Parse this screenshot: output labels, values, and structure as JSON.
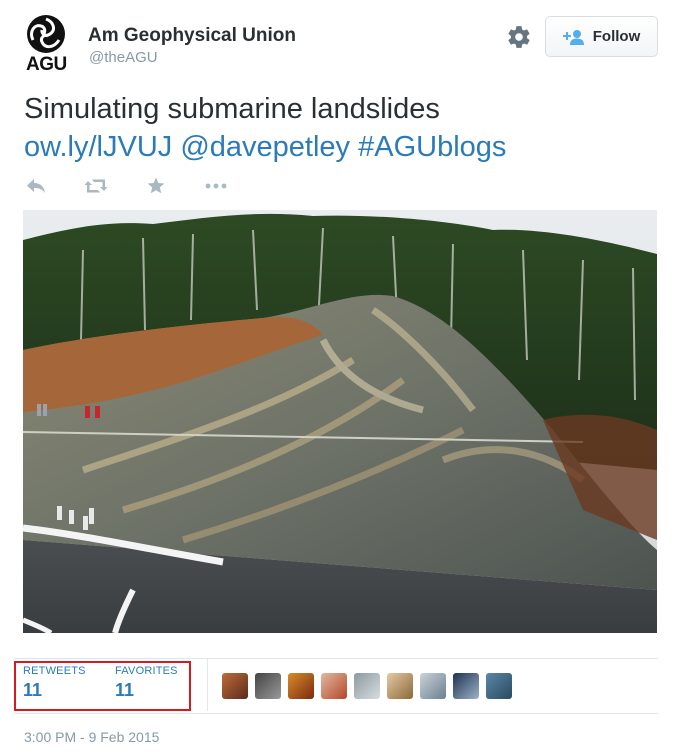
{
  "account": {
    "logo_text": "AGU",
    "name": "Am Geophysical Union",
    "handle": "@theAGU"
  },
  "follow_button": {
    "label": "Follow"
  },
  "tweet": {
    "text": "Simulating submarine landslides",
    "link": "ow.ly/lJVUJ",
    "mention": "@davepetley",
    "hashtag": "#AGUblogs"
  },
  "actions": {
    "icons": [
      "reply-icon",
      "retweet-icon",
      "favorite-icon",
      "more-icon"
    ]
  },
  "stats": {
    "retweets_label": "RETWEETS",
    "retweets_count": "11",
    "favorites_label": "FAVORITES",
    "favorites_count": "11",
    "favoriter_avatar_count_shown": 9
  },
  "timestamp": "3:00 PM - 9 Feb 2015",
  "colors": {
    "link": "#2b7bb9",
    "text": "#292f33",
    "muted": "#8899a6",
    "highlight_box": "#d71920",
    "divider": "#e1e8ed"
  }
}
